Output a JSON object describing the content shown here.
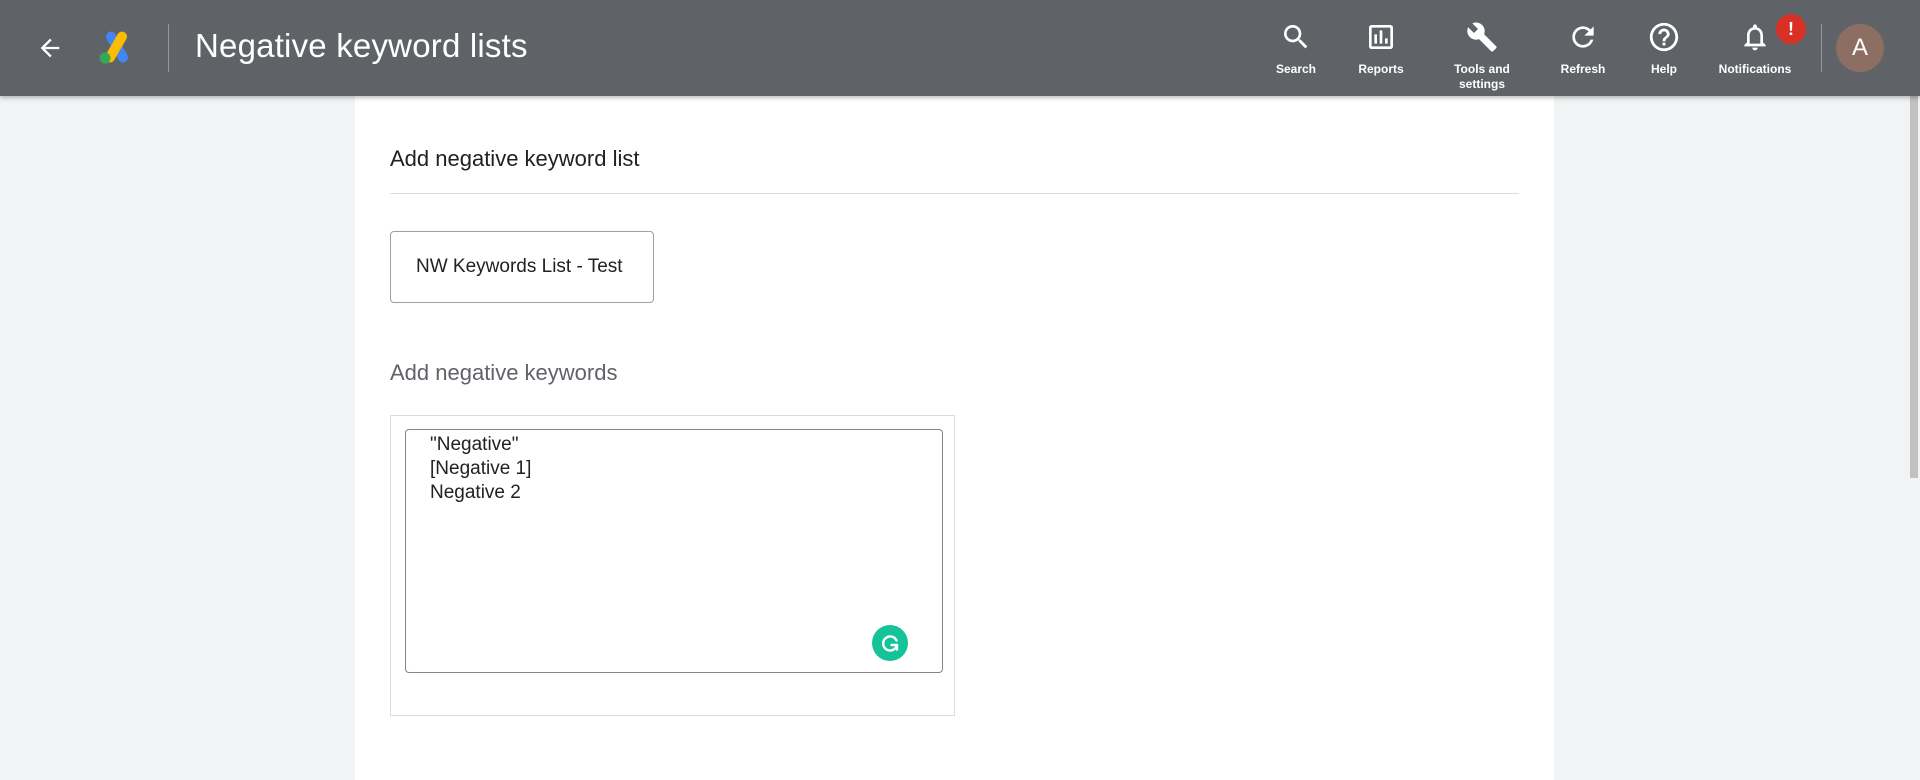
{
  "header": {
    "title": "Negative keyword lists",
    "back_icon": "arrow-left-icon",
    "logo": "google-ads-logo",
    "tools": [
      {
        "label": "Search",
        "icon": "search-icon"
      },
      {
        "label": "Reports",
        "icon": "bar-chart-icon"
      },
      {
        "label": "Tools and settings",
        "icon": "wrench-icon"
      },
      {
        "label": "Refresh",
        "icon": "refresh-icon"
      },
      {
        "label": "Help",
        "icon": "help-circle-icon"
      },
      {
        "label": "Notifications",
        "icon": "bell-icon",
        "badge": "!"
      }
    ],
    "avatar_letter": "A",
    "bar_color": "#5f6368"
  },
  "form": {
    "section_title": "Add negative keyword list",
    "list_name_value": "NW Keywords List - Test",
    "keywords_title": "Add negative keywords",
    "keywords_lines": [
      "\"Negative\"",
      "[Negative 1]",
      "Negative 2"
    ]
  },
  "colors": {
    "badge": "#d93025",
    "grammarly": "#15c39a",
    "avatar": "#8d6e63"
  }
}
